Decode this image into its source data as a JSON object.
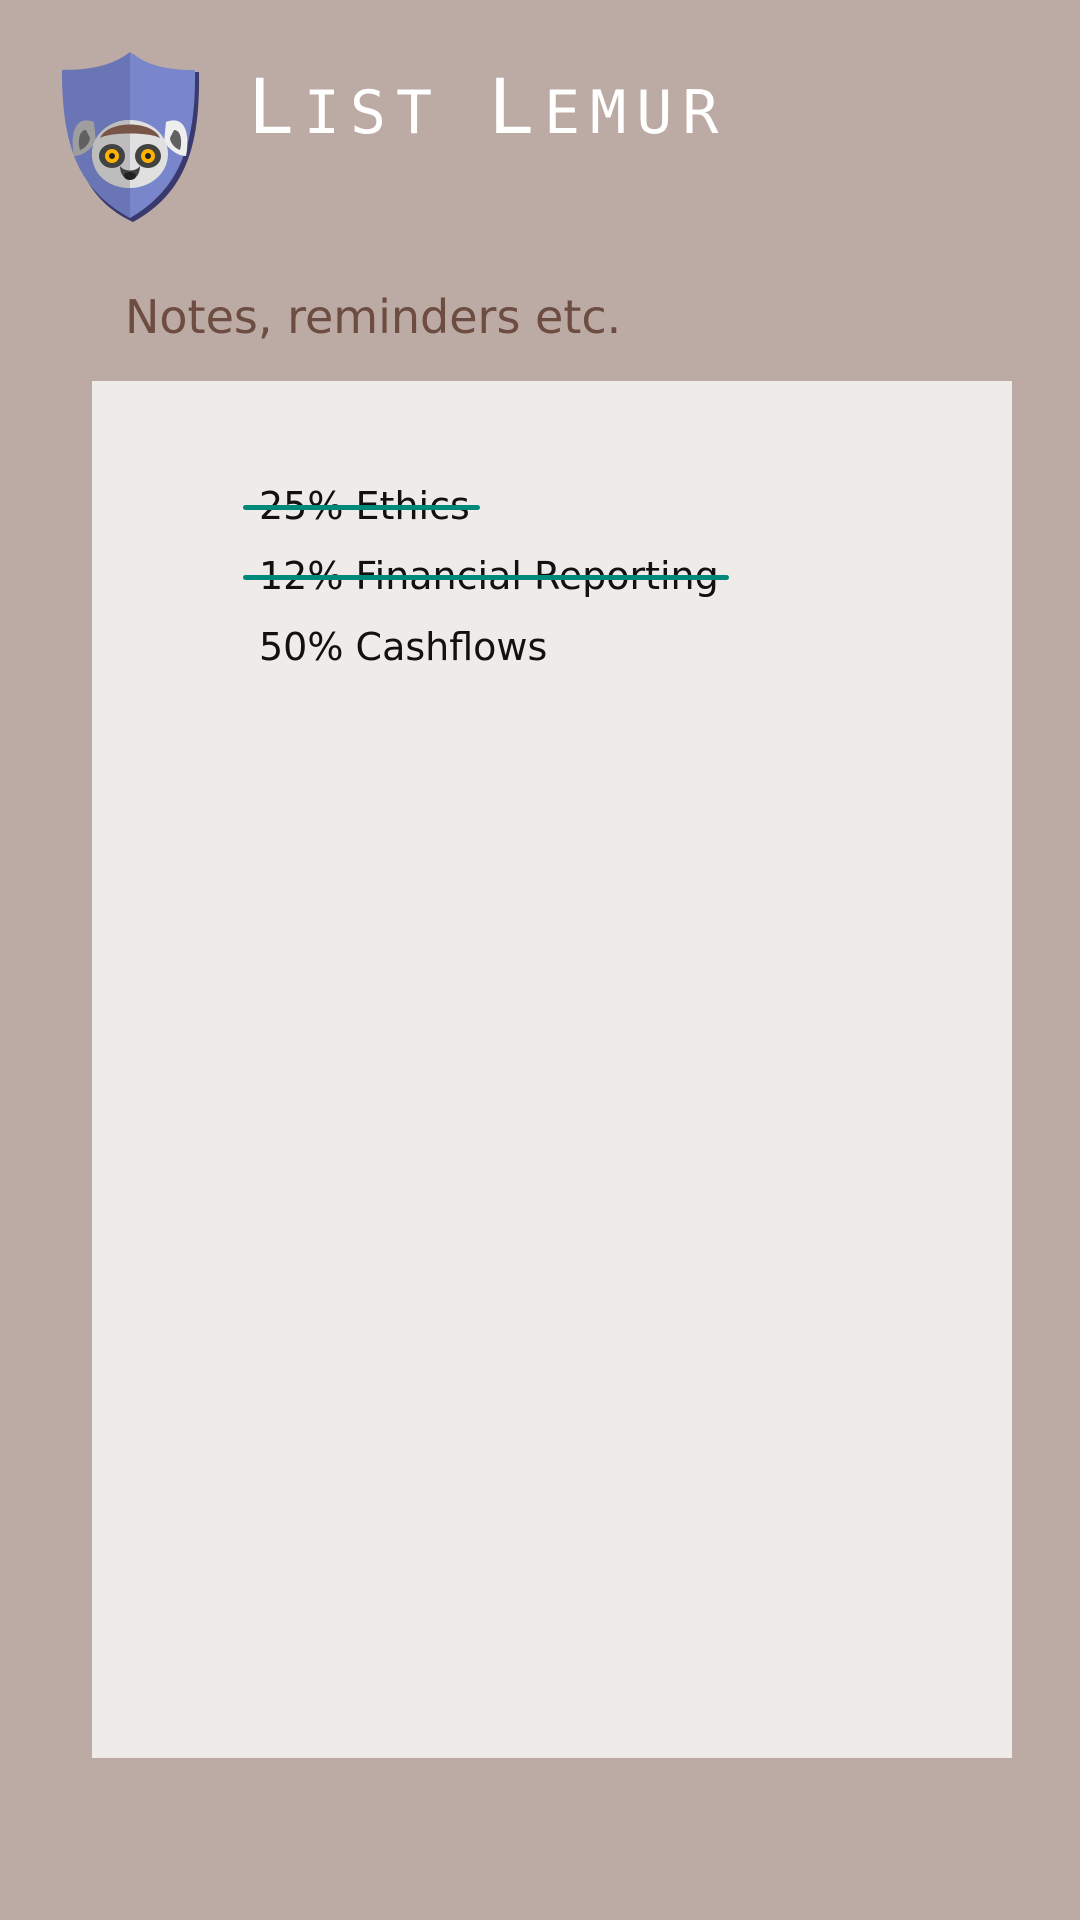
{
  "app": {
    "title": "List Lemur",
    "title_words": [
      "List",
      "Lemur"
    ],
    "logo_icon": "lemur-shield-icon"
  },
  "section": {
    "heading": "Notes, reminders etc."
  },
  "notes": [
    {
      "text": "25% Ethics",
      "done": true
    },
    {
      "text": "12% Financial Reporting",
      "done": true
    },
    {
      "text": "50% Cashflows",
      "done": false
    }
  ],
  "colors": {
    "background": "#bcaaa4",
    "panel": "#efebe9",
    "heading_text": "#6d4c41",
    "strike": "#00897b",
    "shield": "#7986cb"
  }
}
